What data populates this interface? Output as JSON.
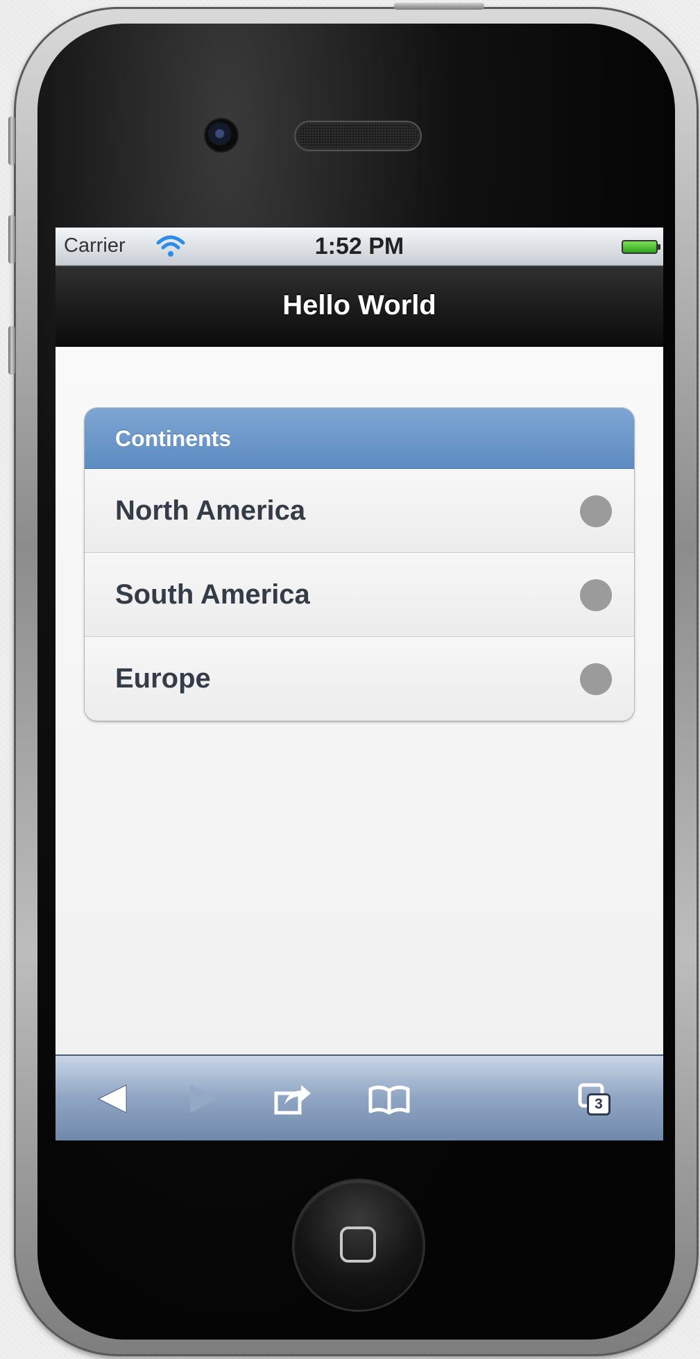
{
  "status_bar": {
    "carrier": "Carrier",
    "time": "1:52 PM",
    "wifi_icon": "wifi-icon",
    "battery_icon": "battery-icon"
  },
  "header": {
    "title": "Hello World"
  },
  "list": {
    "divider": "Continents",
    "items": [
      {
        "label": "North America",
        "icon": "dot-icon"
      },
      {
        "label": "South America",
        "icon": "dot-icon"
      },
      {
        "label": "Europe",
        "icon": "dot-icon"
      }
    ]
  },
  "toolbar": {
    "back_icon": "back-arrow-icon",
    "forward_icon": "forward-arrow-icon",
    "share_icon": "share-icon",
    "bookmarks_icon": "bookmarks-icon",
    "tabs_icon": "tabs-icon",
    "tabs_count": "3"
  },
  "colors": {
    "list_divider": "#6b96c9",
    "header_bg": "#1a1a1a",
    "toolbar_bg": "#8ea4c2",
    "item_text": "#333c47",
    "dot": "#9b9b9b"
  }
}
